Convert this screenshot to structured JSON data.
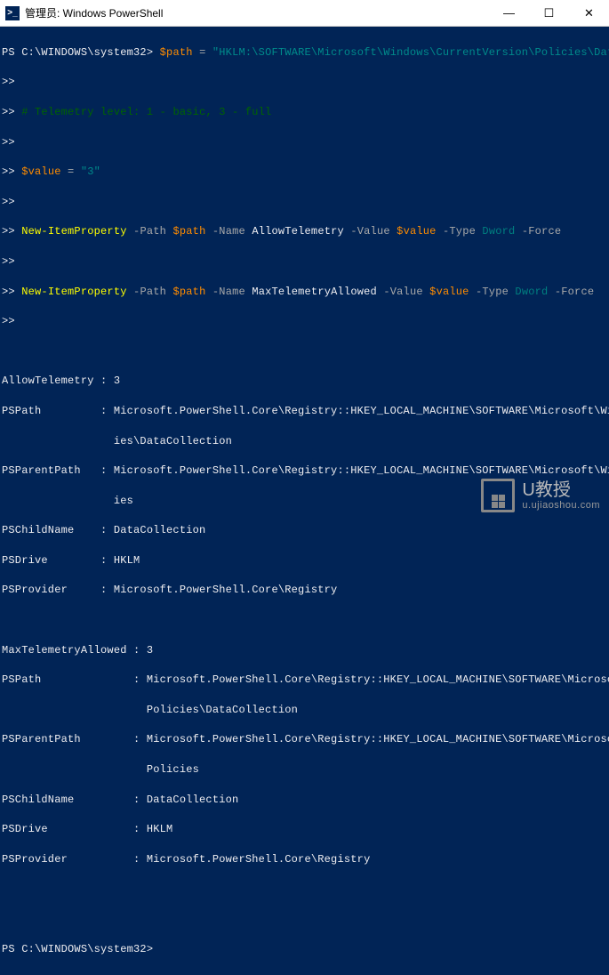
{
  "window": {
    "title": "管理员: Windows PowerShell",
    "icon_glyph": ">_"
  },
  "controls": {
    "min": "—",
    "max": "☐",
    "close": "✕"
  },
  "ps": {
    "prompt_full": "PS C:\\WINDOWS\\system32>",
    "cont": ">>",
    "path_var": "$path",
    "eq": "=",
    "path_str": "\"HKLM:\\SOFTWARE\\Microsoft\\Windows\\CurrentVersion\\Policies\\DataCollection\"",
    "comment": "# Telemetry level: 1 - basic, 3 - full",
    "value_var": "$value",
    "value_str": "\"3\"",
    "cmd1": "New-ItemProperty",
    "cmd2": "New-ItemProperty",
    "p_path": "-Path",
    "p_name": "-Name",
    "name1": "AllowTelemetry",
    "name2": "MaxTelemetryAllowed",
    "p_value": "-Value",
    "p_type": "-Type",
    "type": "Dword",
    "p_force": "-Force"
  },
  "out1": {
    "l1": "AllowTelemetry : 3",
    "l2": "PSPath         : Microsoft.PowerShell.Core\\Registry::HKEY_LOCAL_MACHINE\\SOFTWARE\\Microsoft\\Windows\\CurrentVersion\\Polic",
    "l2b": "                 ies\\DataCollection",
    "l3": "PSParentPath   : Microsoft.PowerShell.Core\\Registry::HKEY_LOCAL_MACHINE\\SOFTWARE\\Microsoft\\Windows\\CurrentVersion\\Polic",
    "l3b": "                 ies",
    "l4": "PSChildName    : DataCollection",
    "l5": "PSDrive        : HKLM",
    "l6": "PSProvider     : Microsoft.PowerShell.Core\\Registry"
  },
  "out2": {
    "l1": "MaxTelemetryAllowed : 3",
    "l2": "PSPath              : Microsoft.PowerShell.Core\\Registry::HKEY_LOCAL_MACHINE\\SOFTWARE\\Microsoft\\Windows\\CurrentVersion\\",
    "l2b": "                      Policies\\DataCollection",
    "l3": "PSParentPath        : Microsoft.PowerShell.Core\\Registry::HKEY_LOCAL_MACHINE\\SOFTWARE\\Microsoft\\Windows\\CurrentVersion\\",
    "l3b": "                      Policies",
    "l4": "PSChildName         : DataCollection",
    "l5": "PSDrive             : HKLM",
    "l6": "PSProvider          : Microsoft.PowerShell.Core\\Registry"
  },
  "watermark": {
    "main": "U教授",
    "sub": "u.ujiaoshou.com"
  }
}
